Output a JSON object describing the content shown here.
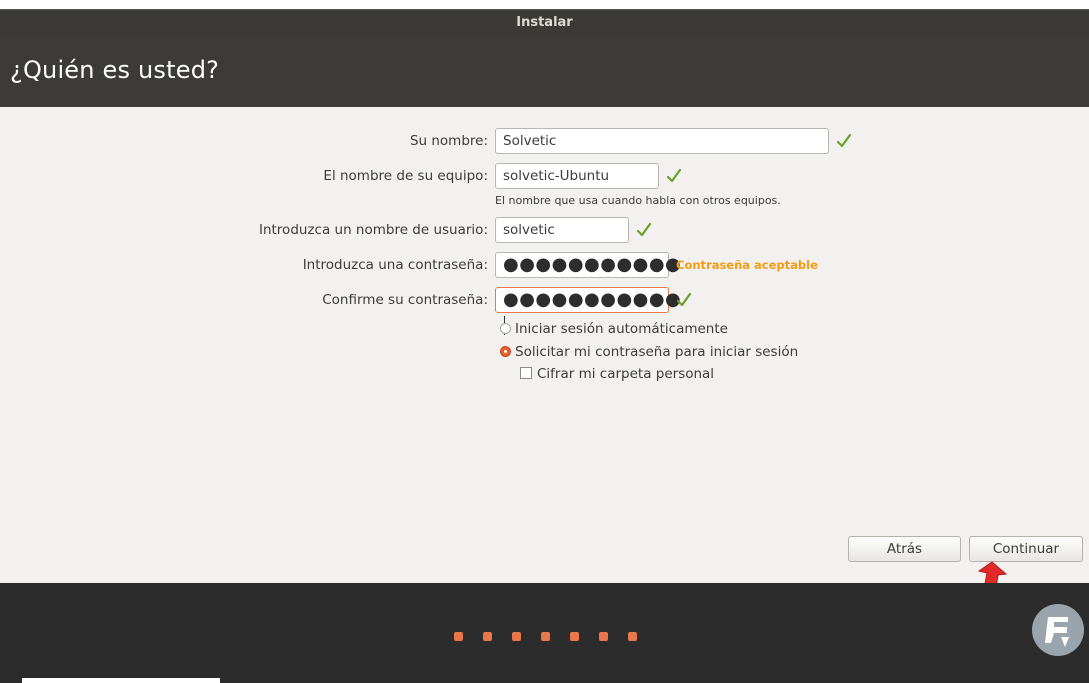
{
  "window": {
    "title": "Instalar"
  },
  "page": {
    "heading": "¿Quién es usted?"
  },
  "form": {
    "name": {
      "label": "Su nombre:",
      "value": "Solvetic"
    },
    "computer": {
      "label": "El nombre de su equipo:",
      "value": "solvetic-Ubuntu",
      "hint": "El nombre que usa cuando habla con otros equipos."
    },
    "username": {
      "label": "Introduzca un nombre de usuario:",
      "value": "solvetic"
    },
    "password": {
      "label": "Introduzca una contraseña:",
      "masked": "●●●●●●●●●●●",
      "strength": "Contraseña aceptable"
    },
    "confirm": {
      "label": "Confirme su contraseña:",
      "masked": "●●●●●●●●●●●"
    },
    "options": {
      "autologin": "Iniciar sesión automáticamente",
      "require_password": "Solicitar mi contraseña para iniciar sesión",
      "encrypt_home": "Cifrar mi carpeta personal"
    }
  },
  "buttons": {
    "back": "Atrás",
    "continue": "Continuar"
  },
  "colors": {
    "accent": "#e9602f",
    "check": "#6aa02a",
    "strength": "#f39c12",
    "header": "#3c3b37"
  },
  "icons": [
    "checkmark-icon",
    "red-arrow-icon",
    "solvetic-logo-icon"
  ],
  "progress": {
    "steps": 7
  }
}
